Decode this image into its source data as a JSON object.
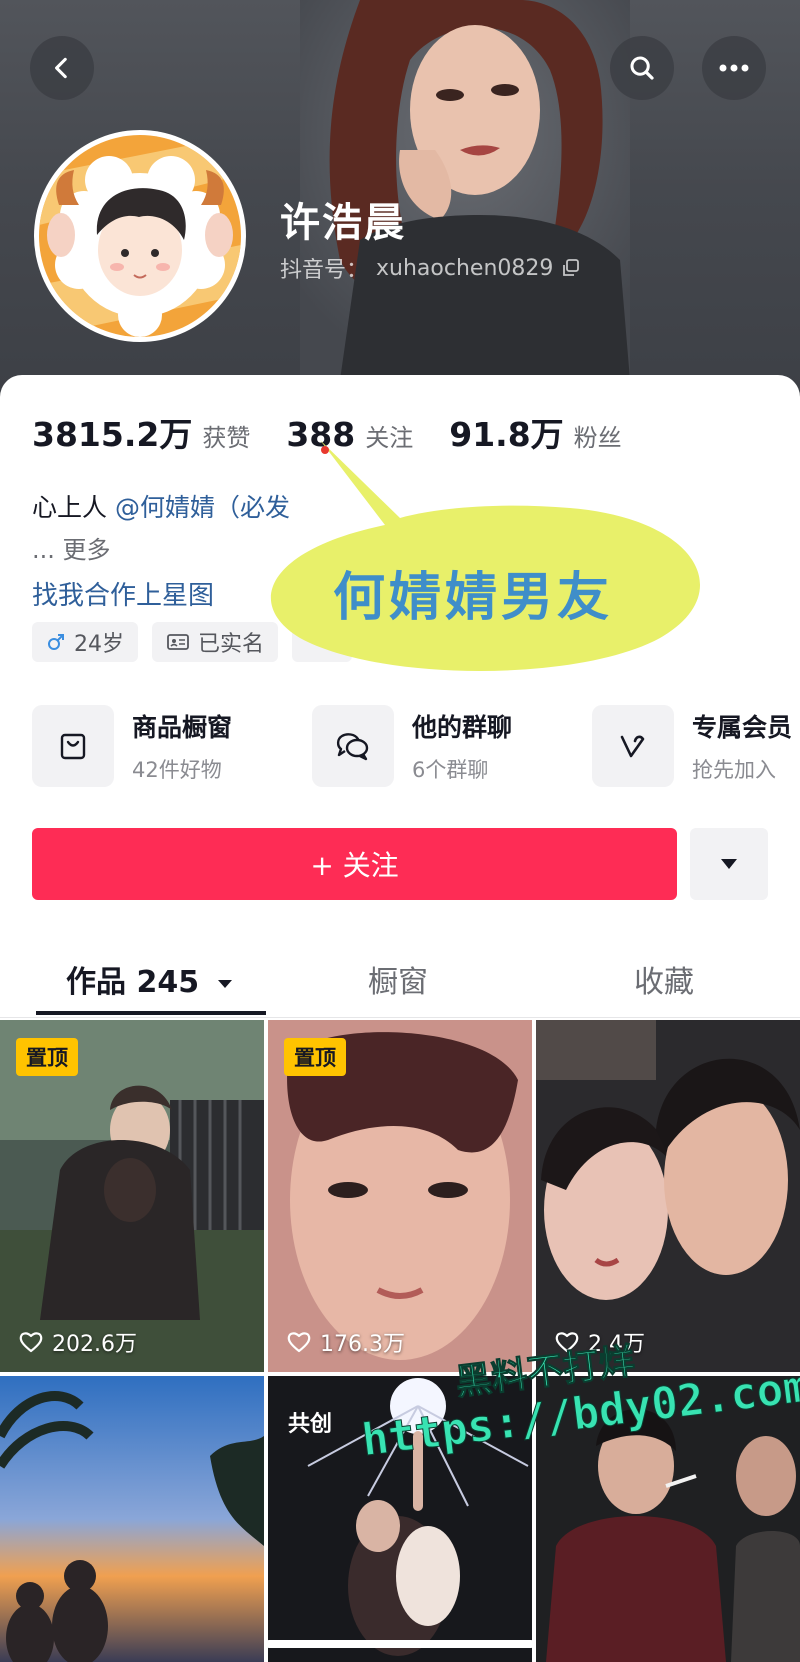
{
  "header": {
    "back_icon": "chevron-left-icon",
    "search_icon": "search-icon",
    "more_icon": "more-horizontal-icon",
    "nickname": "许浩晨",
    "douyin_id_label": "抖音号：",
    "douyin_id": "xuhaochen0829",
    "copy_icon": "copy-icon"
  },
  "stats": [
    {
      "value": "3815.2万",
      "label": "获赞"
    },
    {
      "value": "388",
      "label": "关注"
    },
    {
      "value": "91.8万",
      "label": "粉丝"
    }
  ],
  "bio": {
    "line1_prefix": "心上人",
    "line1_mention": "@何婧婧（必发",
    "line2": "... 更多",
    "line3": "找我合作上星图"
  },
  "tags": [
    {
      "icon": "male-icon",
      "text": "24岁"
    },
    {
      "icon": "id-card-icon",
      "text": "已实名"
    }
  ],
  "annotation": {
    "text": "何婧婧男友",
    "bubble_color": "#e8f06a",
    "text_color": "#3f8ec9"
  },
  "services": [
    {
      "icon": "shopping-bag-icon",
      "title": "商品橱窗",
      "subtitle": "42件好物"
    },
    {
      "icon": "group-chat-icon",
      "title": "他的群聊",
      "subtitle": "6个群聊"
    },
    {
      "icon": "member-v-icon",
      "title": "专属会员",
      "subtitle": "抢先加入"
    }
  ],
  "follow": {
    "label": "+ 关注",
    "dropdown_icon": "caret-down-icon",
    "accent": "#fe2c55"
  },
  "tabs": [
    {
      "label": "作品 245",
      "active": true
    },
    {
      "label": "橱窗",
      "active": false
    },
    {
      "label": "收藏",
      "active": false
    }
  ],
  "videos": [
    {
      "badge": "置顶",
      "likes": "202.6万"
    },
    {
      "badge": "置顶",
      "likes": "176.3万"
    },
    {
      "badge": "",
      "likes": "2.4万"
    },
    {
      "badge": "",
      "likes": ""
    },
    {
      "badge": "共创",
      "likes": ""
    },
    {
      "badge": "",
      "likes": ""
    }
  ],
  "watermark": {
    "line1": "黑料不打烊",
    "line2": "https://bdy02.com"
  }
}
